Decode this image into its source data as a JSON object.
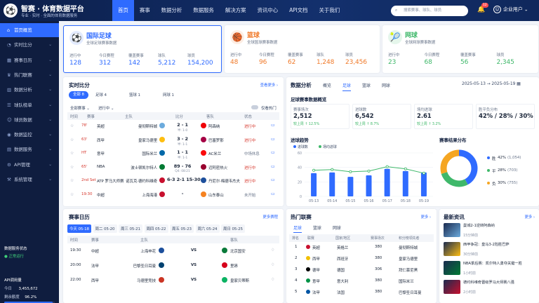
{
  "brand": {
    "title": "智赛 · 体育数据平台",
    "subtitle": "专业 · 实时 · 全面的体育数据服务",
    "logo": "⚽"
  },
  "nav": [
    "首页",
    "赛事",
    "数据分析",
    "数据服务",
    "解决方案",
    "资讯中心",
    "API文档",
    "关于我们"
  ],
  "search": {
    "placeholder": "搜索赛事、球队、球员"
  },
  "header": {
    "notif_count": "12",
    "user": "企业用户"
  },
  "sidebar": [
    {
      "label": "首页概览",
      "icon": "⌂"
    },
    {
      "label": "实时比分",
      "icon": "◔"
    },
    {
      "label": "赛事日历",
      "icon": "▦"
    },
    {
      "label": "热门联赛",
      "icon": "♛"
    },
    {
      "label": "数据分析",
      "icon": "▥"
    },
    {
      "label": "球队榜单",
      "icon": "☰"
    },
    {
      "label": "球员数据",
      "icon": "☺"
    },
    {
      "label": "数据监控",
      "icon": "◉"
    },
    {
      "label": "数据服务",
      "icon": "▤"
    },
    {
      "label": "API管理",
      "icon": "⚙"
    },
    {
      "label": "系统管理",
      "icon": "⚒"
    }
  ],
  "system": {
    "status_label": "数据服务状态",
    "status": "● 正常运行",
    "api_label": "API调用量",
    "today_label": "今日",
    "today_value": "3,455,672",
    "quota_label": "剩余额度",
    "quota_value": "96.2%",
    "quota_fraction": 0.962
  },
  "sport_cards": [
    {
      "name": "国际足球",
      "sub": "全球足球赛事数据",
      "color": "#2f6bff",
      "icon": "⚽",
      "stats": [
        {
          "l": "进行中",
          "v": "128"
        },
        {
          "l": "今日赛程",
          "v": "312"
        },
        {
          "l": "覆盖赛事",
          "v": "142"
        },
        {
          "l": "球队",
          "v": "5,212"
        },
        {
          "l": "球员",
          "v": "154,200"
        }
      ]
    },
    {
      "name": "篮球",
      "sub": "全球篮球赛事数据",
      "color": "#f07a2a",
      "icon": "🏀",
      "stats": [
        {
          "l": "进行中",
          "v": "48"
        },
        {
          "l": "今日赛程",
          "v": "96"
        },
        {
          "l": "覆盖赛事",
          "v": "62"
        },
        {
          "l": "球队",
          "v": "1,248"
        },
        {
          "l": "球员",
          "v": "23,456"
        }
      ]
    },
    {
      "name": "网球",
      "sub": "全球网球赛事数据",
      "color": "#3fb86a",
      "icon": "🎾",
      "stats": [
        {
          "l": "进行中",
          "v": "23"
        },
        {
          "l": "今日赛程",
          "v": "68"
        },
        {
          "l": "覆盖赛事",
          "v": "56"
        },
        {
          "l": "球员",
          "v": "2,345"
        }
      ]
    }
  ],
  "live": {
    "title": "实时比分",
    "more": "查看更多 ›",
    "tabs": [
      "全部 8",
      "足球 4",
      "篮球 1",
      "网球 1"
    ],
    "filter1": "全部赛事 ⌄",
    "filter2": "进行中 ⌄",
    "toggle": "仅看热门",
    "headers": [
      "时间",
      "赛事",
      "主队",
      "比分",
      "客队",
      "状态"
    ],
    "rows": [
      {
        "time": "78'",
        "league": "英超",
        "home": "曼彻斯特城",
        "score": "2 - 1",
        "sub": "半: 1-0",
        "away": "阿森纳",
        "status": "进行中",
        "hc": "#6cabdd",
        "ac": "#ef0107"
      },
      {
        "time": "63'",
        "league": "西甲",
        "home": "皇家马德里",
        "score": "3 - 2",
        "sub": "半: 1-1",
        "away": "巴塞罗那",
        "status": "进行中",
        "hc": "#febe10",
        "ac": "#a50044"
      },
      {
        "time": "HT",
        "league": "意甲",
        "home": "国际米兰",
        "score": "1 - 1",
        "sub": "半: 1-1",
        "away": "AC米兰",
        "status": "中场休息",
        "hc": "#0068a8",
        "ac": "#fb090b"
      },
      {
        "time": "65'",
        "league": "NBA",
        "home": "波士顿凯尔特人",
        "score": "89 - 76",
        "sub": "Q4: 08:21",
        "away": "迈阿密热火",
        "status": "进行中",
        "hc": "#007a33",
        "ac": "#98002e"
      },
      {
        "time": "2nd Set",
        "league": "ATP 罗马大师赛",
        "home": "诺瓦克·德约科维奇",
        "score": "6-3  2-1  15-30",
        "sub": "",
        "away": "丹尼尔·梅德韦杰夫",
        "status": "进行中",
        "hc": "#c8102e",
        "ac": "#1d4f9c"
      },
      {
        "time": "19:30",
        "league": "中超",
        "home": "上海海港",
        "score": "-",
        "sub": "",
        "away": "山东泰山",
        "status": "未开始",
        "hc": "#c8102e",
        "ac": "#f58220"
      }
    ]
  },
  "analysis": {
    "title": "数据分析",
    "tabs": [
      "概览",
      "足球",
      "篮球",
      "网球"
    ],
    "date_from": "2025-05-13",
    "date_to": "2025-05-19",
    "subtitle": "足球赛事数据概览",
    "kpis": [
      {
        "l": "赛事场次",
        "v": "2,512",
        "c": "较上周 ↑ 12.5%"
      },
      {
        "l": "进球数",
        "v": "6,542",
        "c": "较上周 ↑ 8.7%"
      },
      {
        "l": "场均进球",
        "v": "2.61",
        "c": "较上周 ↑ 3.2%"
      },
      {
        "l": "胜平负分布",
        "v": "42% / 28% / 30%",
        "c": ""
      }
    ],
    "chart_title": "进球趋势",
    "distribution_title": "赛事结果分布",
    "donut": [
      {
        "label": "胜",
        "pct": "42%",
        "count": "(1,054)",
        "color": "#2f6bff",
        "v": 0.42
      },
      {
        "label": "平",
        "pct": "28%",
        "count": "(703)",
        "color": "#3fb86a",
        "v": 0.28
      },
      {
        "label": "负",
        "pct": "30%",
        "count": "(755)",
        "color": "#f5a623",
        "v": 0.3
      }
    ]
  },
  "chart_data": {
    "type": "bar",
    "title": "进球趋势",
    "categories": [
      "05-13",
      "05-14",
      "05-15",
      "05-16",
      "05-17",
      "05-18",
      "05-19"
    ],
    "ylim": [
      0,
      60
    ],
    "yticks": [
      "60",
      "40",
      "20",
      "0"
    ],
    "series": [
      {
        "name": "进球数",
        "type": "bar",
        "values": [
          32,
          33,
          27,
          29,
          38,
          35,
          33
        ]
      },
      {
        "name": "场均进球",
        "type": "line",
        "values": [
          36,
          37,
          34,
          35,
          41,
          38,
          32
        ]
      }
    ]
  },
  "schedule": {
    "title": "赛事日历",
    "more": "更多赛程",
    "days": [
      "今天 05-18",
      "周二 05-20",
      "周三 05-21",
      "周四 05-22",
      "周五 05-23",
      "周六 05-24",
      "周日 05-25"
    ],
    "headers": [
      "时间",
      "赛事",
      "主队",
      "",
      "客队"
    ],
    "rows": [
      {
        "time": "19:30",
        "league": "中超",
        "home": "上海申花",
        "vs": "VS",
        "away": "北京国安",
        "hc": "#1d4f9c",
        "ac": "#0a7a3a"
      },
      {
        "time": "20:00",
        "league": "法甲",
        "home": "巴黎圣日耳曼",
        "vs": "VS",
        "away": "里昂",
        "hc": "#004170",
        "ac": "#d6001c"
      },
      {
        "time": "22:00",
        "league": "西甲",
        "home": "马德里竞技",
        "vs": "VS",
        "away": "皇家贝蒂斯",
        "hc": "#cb3524",
        "ac": "#0bb363"
      }
    ]
  },
  "leagues": {
    "title": "热门联赛",
    "more": "更多 ›",
    "tabs": [
      "足球",
      "篮球",
      "网球"
    ],
    "headers": [
      "排名",
      "联赛",
      "国家/地区",
      "赛事场次",
      "积分榜领先者"
    ],
    "rows": [
      {
        "rank": "1",
        "name": "英超",
        "country": "英格兰",
        "games": "380",
        "leader": "曼彻斯特城"
      },
      {
        "rank": "2",
        "name": "西甲",
        "country": "西班牙",
        "games": "380",
        "leader": "皇家马德里"
      },
      {
        "rank": "3",
        "name": "德甲",
        "country": "德国",
        "games": "306",
        "leader": "拜仁慕尼黑"
      },
      {
        "rank": "4",
        "name": "意甲",
        "country": "意大利",
        "games": "380",
        "leader": "国际米兰"
      },
      {
        "rank": "5",
        "name": "法甲",
        "country": "法国",
        "games": "380",
        "leader": "巴黎圣日耳曼"
      }
    ]
  },
  "news": {
    "title": "最新资讯",
    "more": "更多 ›",
    "items": [
      {
        "t": "曼城2-1逆转阿森纳",
        "time": "15分钟前"
      },
      {
        "t": "西甲争冠：皇马3-2险胜巴萨",
        "time": "30分钟前"
      },
      {
        "t": "NBA季后赛：凯尔特人勇夺关键一胜",
        "time": "1小时前"
      },
      {
        "t": "德约科维奇晋级罗马大师赛八强",
        "time": "2小时前"
      }
    ]
  }
}
